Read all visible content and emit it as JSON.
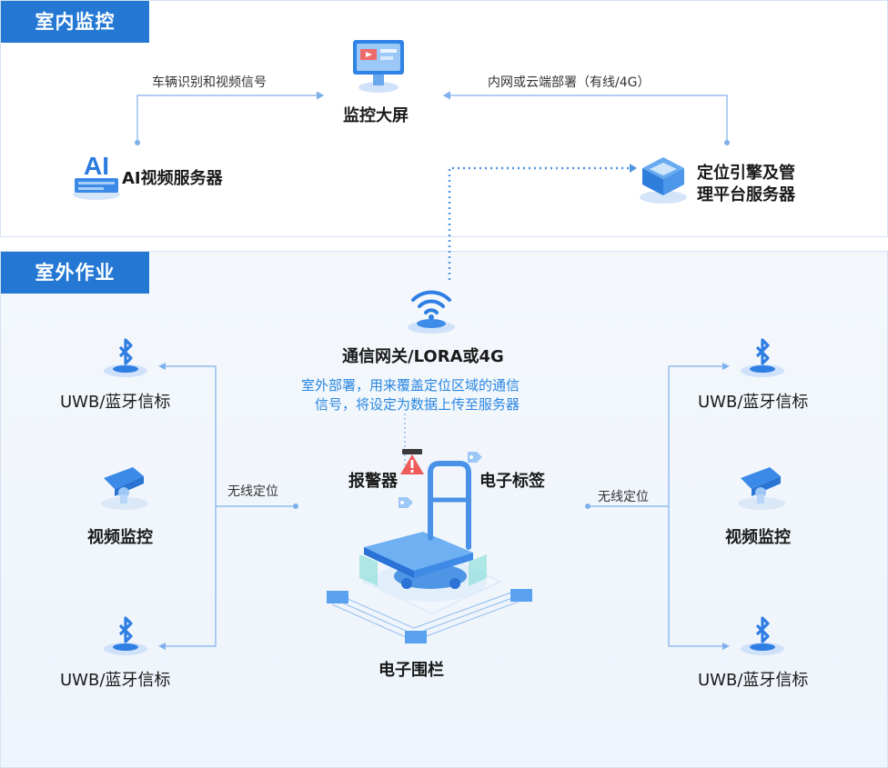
{
  "indoor": {
    "title": "室内监控",
    "screen_label": "监控大屏",
    "ai_server_label": "AI视频服务器",
    "positioning_server_label_1": "定位引擎及管",
    "positioning_server_label_2": "理平台服务器",
    "edge_left_label": "车辆识别和视频信号",
    "edge_right_label": "内网或云端部署（有线/4G）",
    "ai_icon_text": "AI"
  },
  "outdoor": {
    "title": "室外作业",
    "gateway_label": "通信网关/LORA或4G",
    "gateway_desc_1": "室外部署，用来覆盖定位区域的通信",
    "gateway_desc_2": "信号，将设定为数据上传至服务器",
    "left_beacon_top": "UWB/蓝牙信标",
    "left_video": "视频监控",
    "left_beacon_bottom": "UWB/蓝牙信标",
    "right_beacon_top": "UWB/蓝牙信标",
    "right_video": "视频监控",
    "right_beacon_bottom": "UWB/蓝牙信标",
    "left_wireless": "无线定位",
    "right_wireless": "无线定位",
    "alarm_label": "报警器",
    "tag_label": "电子标签",
    "fence_label": "电子围栏"
  },
  "colors": {
    "accent": "#2478d4",
    "line": "#7fb0ea",
    "desc_text": "#2a86e0"
  },
  "icons": [
    "monitor-screen-icon",
    "ai-server-icon",
    "server-stack-icon",
    "wifi-gateway-icon",
    "bluetooth-icon",
    "camera-icon",
    "cart-icon",
    "alarm-icon",
    "tag-icon"
  ]
}
